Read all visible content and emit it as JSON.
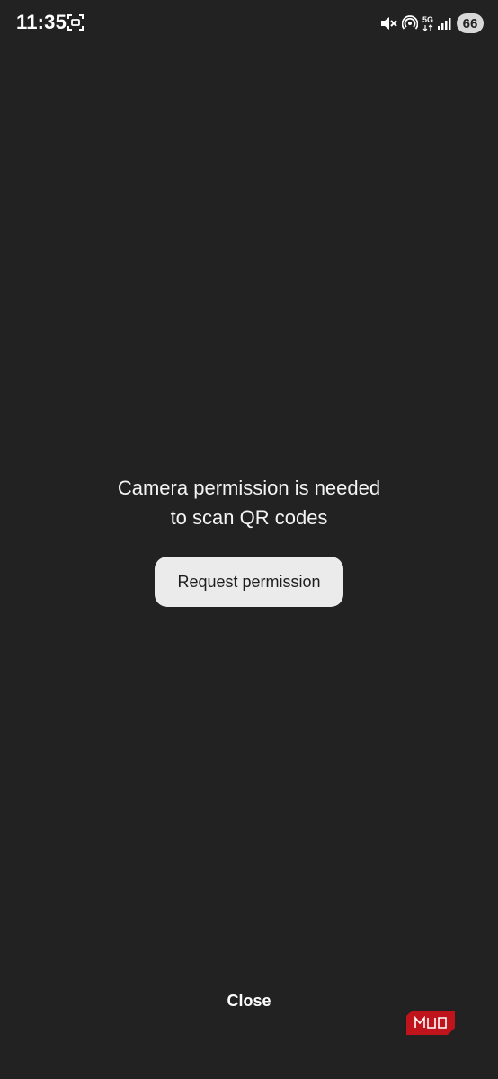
{
  "status_bar": {
    "time": "11:35",
    "network_type": "5G",
    "battery_level": "66",
    "icons": [
      "screenshot-icon",
      "mute-icon",
      "hotspot-icon",
      "signal-icon",
      "battery-icon"
    ]
  },
  "permission": {
    "message_line1": "Camera permission is needed",
    "message_line2": "to scan QR codes",
    "button_label": "Request permission"
  },
  "footer": {
    "close_label": "Close"
  },
  "watermark": {
    "text": "MUO"
  },
  "colors": {
    "background": "#222222",
    "button_bg": "#ebebeb",
    "text": "#f4f4f4",
    "watermark": "#c0141c"
  }
}
